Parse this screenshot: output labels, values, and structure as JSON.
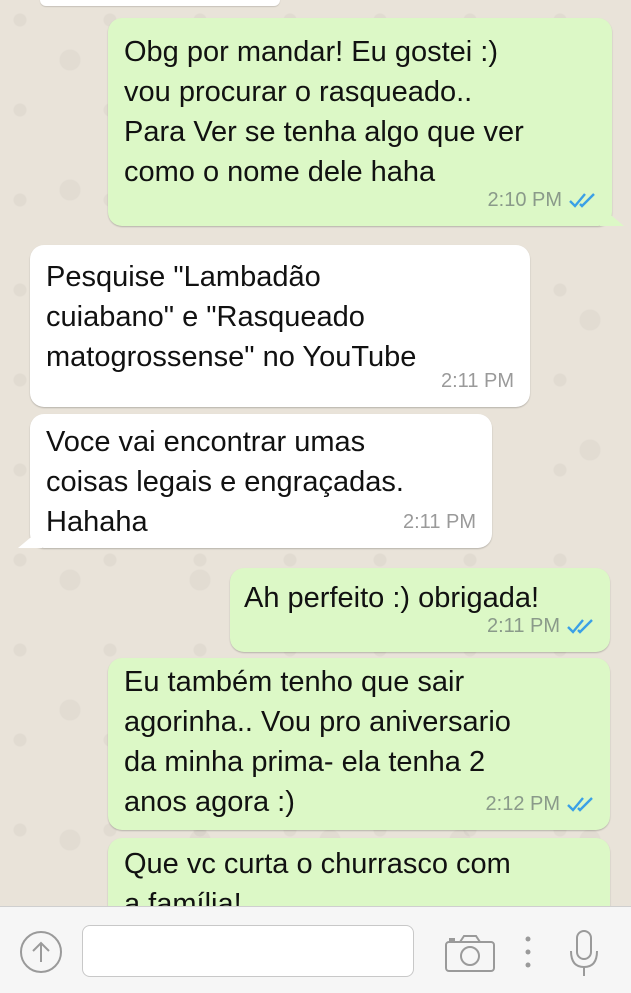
{
  "messages": [
    {
      "direction": "out",
      "text": "Obg por mandar! Eu gostei :)\nvou procurar o rasqueado..\nPara Ver se tenha algo que ver\ncomo o nome dele haha",
      "time": "2:10 PM",
      "read": true
    },
    {
      "direction": "in",
      "text": "Pesquise \"Lambadão\ncuiabano\" e \"Rasqueado\nmatogrossense\" no YouTube",
      "time": "2:11 PM"
    },
    {
      "direction": "in",
      "text": "Voce vai encontrar umas\ncoisas legais e engraçadas.\nHahaha",
      "time": "2:11 PM"
    },
    {
      "direction": "out",
      "text": "Ah perfeito :) obrigada!",
      "time": "2:11 PM",
      "read": true
    },
    {
      "direction": "out",
      "text": "Eu também tenho que sair\nagorinha.. Vou pro aniversario\nda minha prima- ela tenha 2\nanos agora :)",
      "time": "2:12 PM",
      "read": true
    },
    {
      "direction": "out",
      "text": "Que vc curta o churrasco com\na família!",
      "time": ""
    }
  ],
  "input": {
    "value": "",
    "placeholder": ""
  },
  "icons": {
    "upload": "arrow-up-circle-icon",
    "camera": "camera-icon",
    "more": "vertical-dots-icon",
    "mic": "microphone-icon",
    "read_receipt": "double-check-icon"
  },
  "colors": {
    "outgoing_bubble": "#dcf8c6",
    "incoming_bubble": "#ffffff",
    "read_ticks": "#3aa0e6",
    "background": "#e9e3d9"
  }
}
